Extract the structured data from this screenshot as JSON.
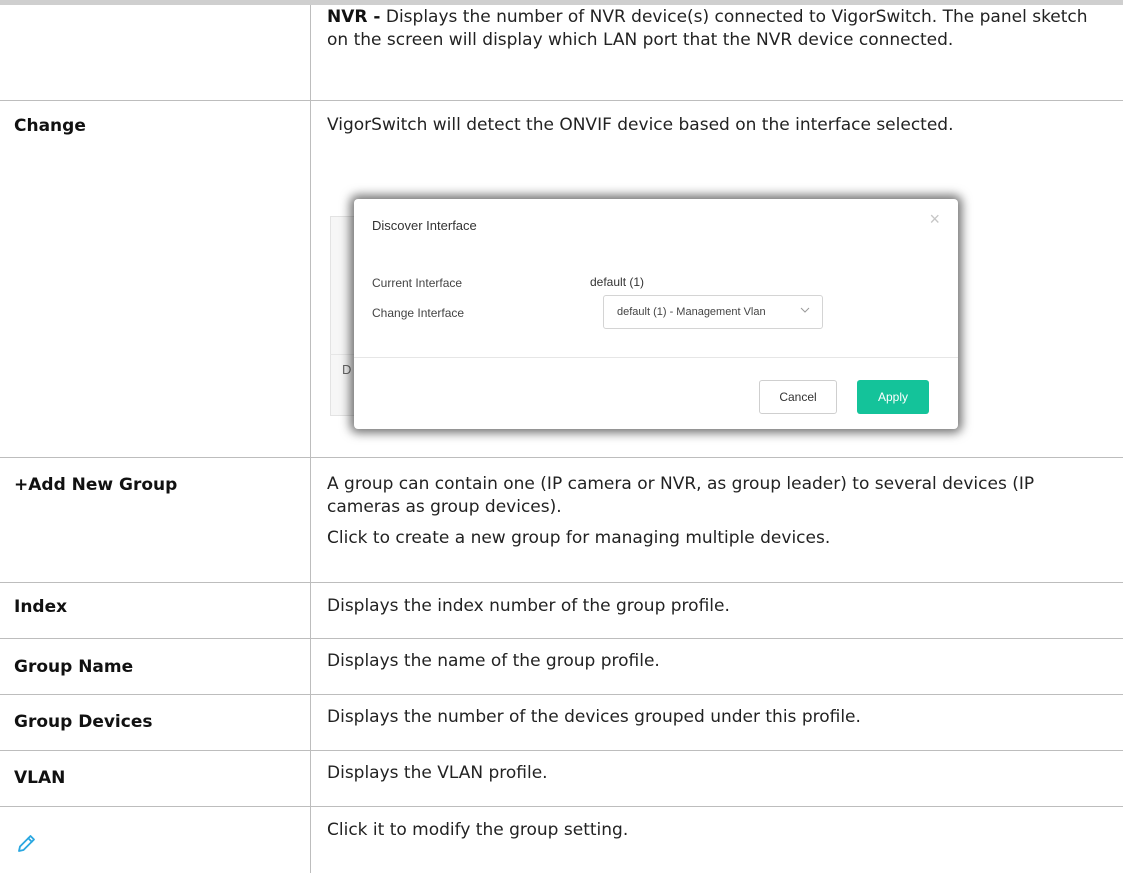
{
  "rows": {
    "nvr": {
      "bold": "NVR -",
      "text": " Displays the number of NVR device(s) connected to VigorSwitch. The panel sketch on the screen will display which LAN port that the NVR device connected."
    },
    "change": {
      "term": "Change",
      "desc": "VigorSwitch will detect the ONVIF device based on the interface selected."
    },
    "add_group": {
      "term": "+Add New Group",
      "desc1": "A group can contain one (IP camera or NVR, as group leader) to several devices (IP cameras as group devices).",
      "desc2": "Click to create a new group for managing multiple devices."
    },
    "index": {
      "term": "Index",
      "desc": "Displays the index number of the group profile."
    },
    "group_name": {
      "term": "Group Name",
      "desc": "Displays the name of the group profile."
    },
    "group_devices": {
      "term": "Group Devices",
      "desc": "Displays the number of the devices grouped under this profile."
    },
    "vlan": {
      "term": "VLAN",
      "desc": "Displays the VLAN profile."
    },
    "edit": {
      "icon": "pencil-icon",
      "desc": "Click it to modify the group setting."
    }
  },
  "dialog": {
    "title": "Discover Interface",
    "current_label": "Current Interface",
    "current_value": "default (1)",
    "change_label": "Change Interface",
    "select_value": "default (1) - Management Vlan",
    "cancel": "Cancel",
    "apply": "Apply",
    "bg_fragment": "D",
    "close_glyph": "×"
  },
  "colors": {
    "apply_button": "#14c39a",
    "pencil_icon": "#2aa7e0",
    "grid_lines": "#bdbdbd"
  }
}
